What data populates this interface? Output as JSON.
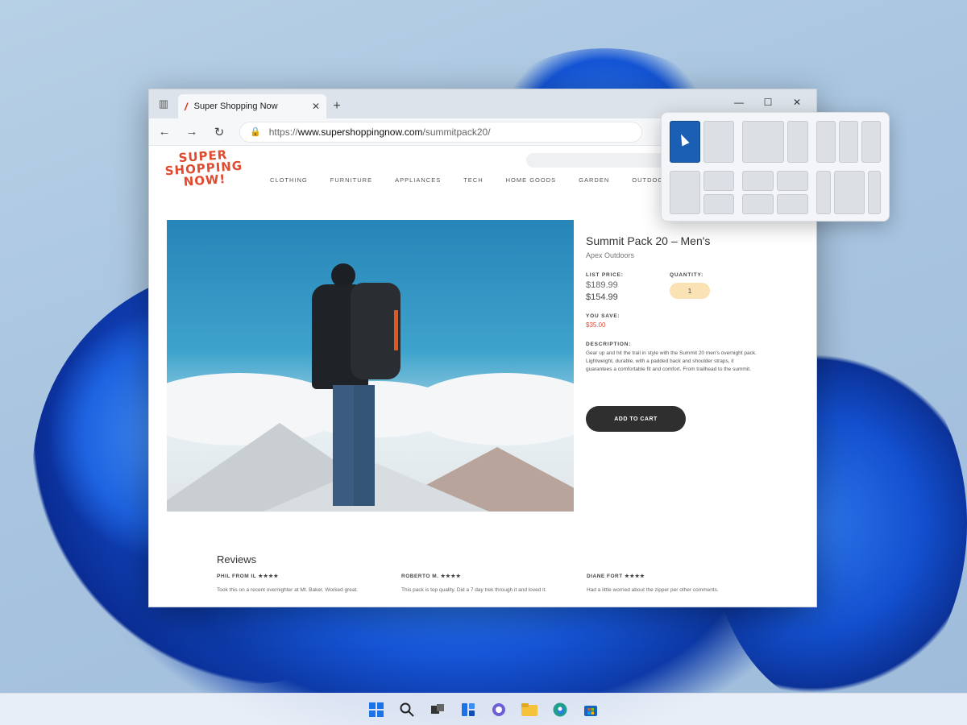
{
  "browser": {
    "tab_title": "Super Shopping Now",
    "url_prefix": "https://",
    "url_domain": "www.supershoppingnow.com",
    "url_path": "/summitpack20/"
  },
  "site": {
    "logo_line1": "SUPER",
    "logo_line2": "SHOPPING",
    "logo_line3": "NOW!",
    "nav": [
      "CLOTHING",
      "FURNITURE",
      "APPLIANCES",
      "TECH",
      "HOME GOODS",
      "GARDEN",
      "OUTDOOR"
    ]
  },
  "product": {
    "title": "Summit Pack 20 – Men's",
    "brand": "Apex Outdoors",
    "list_price_label": "LIST PRICE:",
    "list_price": "$189.99",
    "sale_price": "$154.99",
    "quantity_label": "QUANTITY:",
    "quantity": "1",
    "you_save_label": "YOU SAVE:",
    "you_save": "$35.00",
    "description_label": "DESCRIPTION:",
    "description": "Gear up and hit the trail in style with the Summit 20 men's overnight pack. Lightweight, durable, with a padded back and shoulder straps, it guarantees a comfortable fit and comfort. From trailhead to the summit.",
    "add_to_cart": "ADD TO CART"
  },
  "reviews": {
    "title": "Reviews",
    "items": [
      {
        "author": "PHIL FROM IL",
        "rating": "★★★★",
        "text": "Took this on a recent overnighter at Mt. Baker. Worked great."
      },
      {
        "author": "ROBERTO M.",
        "rating": "★★★★",
        "text": "This pack is top quality. Did a 7 day trek through it and loved it."
      },
      {
        "author": "DIANE FORT",
        "rating": "★★★★",
        "text": "Had a little worried about the zipper per other comments."
      }
    ]
  },
  "colors": {
    "accent": "#1a5fb4",
    "logo": "#e04a2e",
    "quantity_bg": "#fbe2b4",
    "cart_button": "#2f2f2f"
  }
}
